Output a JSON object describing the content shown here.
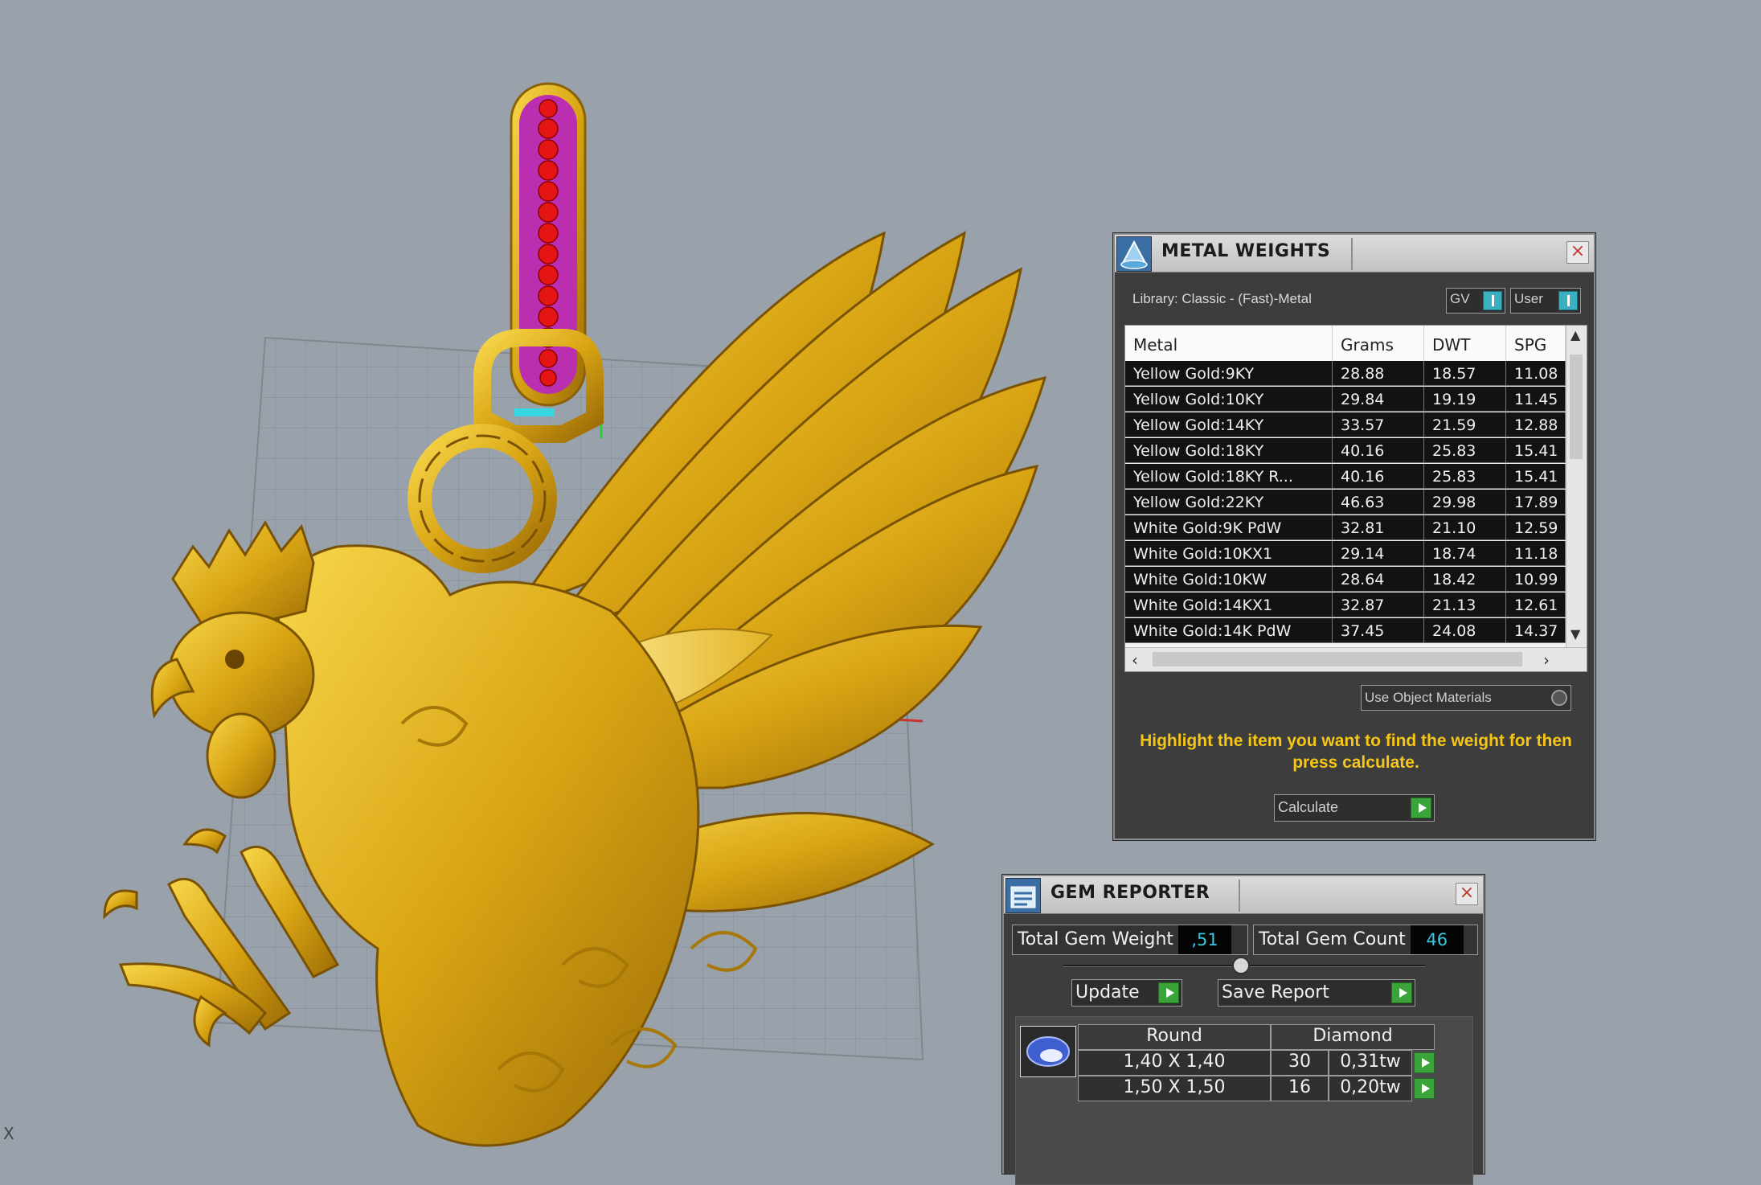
{
  "viewport": {
    "axis_label": "X"
  },
  "metal_weights": {
    "title": "METAL WEIGHTS",
    "library": "Library: Classic - (Fast)-Metal",
    "toggle_gv": "GV",
    "toggle_user": "User",
    "columns": [
      "Metal",
      "Grams",
      "DWT",
      "SPG"
    ],
    "rows": [
      {
        "metal": "Yellow Gold:9KY",
        "grams": "28.88",
        "dwt": "18.57",
        "spg": "11.08"
      },
      {
        "metal": "Yellow Gold:10KY",
        "grams": "29.84",
        "dwt": "19.19",
        "spg": "11.45"
      },
      {
        "metal": "Yellow Gold:14KY",
        "grams": "33.57",
        "dwt": "21.59",
        "spg": "12.88"
      },
      {
        "metal": "Yellow Gold:18KY",
        "grams": "40.16",
        "dwt": "25.83",
        "spg": "15.41"
      },
      {
        "metal": "Yellow Gold:18KY R...",
        "grams": "40.16",
        "dwt": "25.83",
        "spg": "15.41"
      },
      {
        "metal": "Yellow Gold:22KY",
        "grams": "46.63",
        "dwt": "29.98",
        "spg": "17.89"
      },
      {
        "metal": "White Gold:9K PdW",
        "grams": "32.81",
        "dwt": "21.10",
        "spg": "12.59"
      },
      {
        "metal": "White Gold:10KX1",
        "grams": "29.14",
        "dwt": "18.74",
        "spg": "11.18"
      },
      {
        "metal": "White Gold:10KW",
        "grams": "28.64",
        "dwt": "18.42",
        "spg": "10.99"
      },
      {
        "metal": "White Gold:14KX1",
        "grams": "32.87",
        "dwt": "21.13",
        "spg": "12.61"
      },
      {
        "metal": "White Gold:14K PdW",
        "grams": "37.45",
        "dwt": "24.08",
        "spg": "14.37"
      }
    ],
    "use_object_materials": "Use Object Materials",
    "hint": "Highlight the item you want to find the weight for then press calculate.",
    "calculate_label": "Calculate"
  },
  "gem_reporter": {
    "title": "GEM REPORTER",
    "total_weight_label": "Total Gem Weight",
    "total_weight_value": ",51",
    "total_count_label": "Total Gem Count",
    "total_count_value": "46",
    "update_label": "Update",
    "save_report_label": "Save Report",
    "gem_shape": "Round",
    "gem_type": "Diamond",
    "gems": [
      {
        "size": "1,40 X 1,40",
        "count": "30",
        "weight": "0,31tw"
      },
      {
        "size": "1,50 X 1,50",
        "count": "16",
        "weight": "0,20tw"
      }
    ]
  },
  "colors": {
    "background": "#99a1ab",
    "gold": "#e0ad1c",
    "hint_yellow": "#f5c518",
    "accent_teal": "#38c8e0",
    "play_green": "#3aa43a"
  }
}
